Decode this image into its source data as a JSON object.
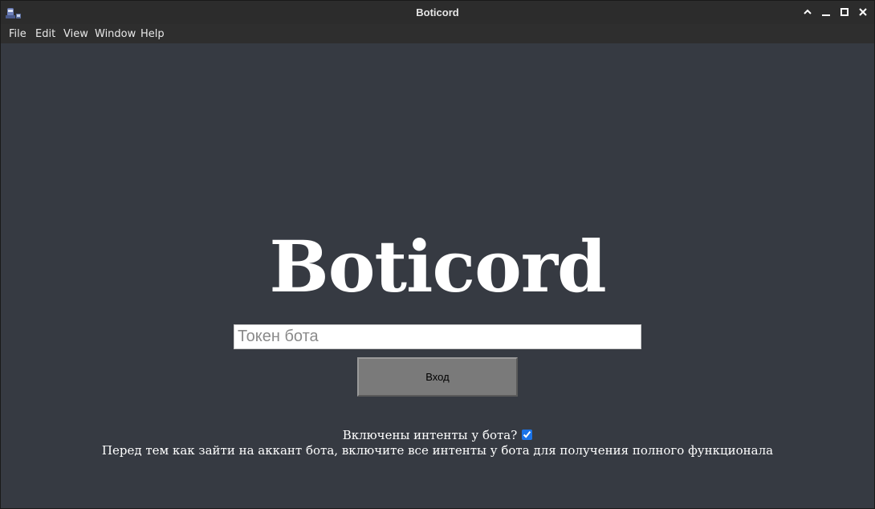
{
  "window": {
    "title": "Boticord"
  },
  "menu": {
    "items": [
      "File",
      "Edit",
      "View",
      "Window",
      "Help"
    ]
  },
  "main": {
    "heading": "Boticord",
    "token_input": {
      "placeholder": "Токен бота",
      "value": ""
    },
    "login_button": "Вход",
    "intents_label": "Включены интенты у бота?",
    "intents_checked": true,
    "hint": "Перед тем как зайти на аккант бота, включите все интенты у бота для получения полного функционала"
  },
  "colors": {
    "background": "#363a42",
    "titlebar": "#2c2c2c",
    "button": "#7a7a7a",
    "checkbox_accent": "#1a73e8"
  }
}
